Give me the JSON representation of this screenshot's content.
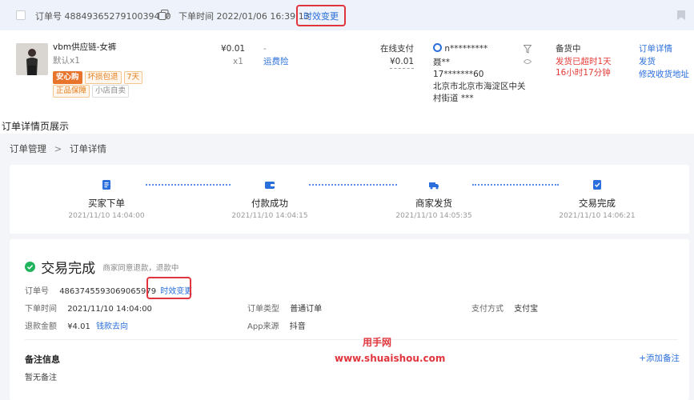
{
  "order_card": {
    "order_no_label": "订单号",
    "order_no": "4884936527910039440",
    "order_time_label": "下单时间",
    "order_time": "2022/01/06 16:39:13",
    "time_change_link": "时效变更",
    "product_name": "vbm供应链-女裤",
    "product_sku": "默认x1",
    "tags_row1": [
      "安心购",
      "坏损包退",
      "7天"
    ],
    "tags_row2": [
      "正品保障",
      "小店自卖"
    ],
    "price": "¥0.01",
    "qty": "x1",
    "dash": "-",
    "freight_link": "运费险",
    "pay_method": "在线支付",
    "pay_amount": "¥0.01",
    "buyer_nick": "n*********",
    "receiver_name": "聂**",
    "receiver_phone": "17*******60",
    "receiver_address": "北京市北京市海淀区中关村街道 ***",
    "status": "备货中",
    "overdue": "发货已超时1天",
    "overdue_time": "16小时17分钟",
    "actions": [
      "订单详情",
      "发货",
      "修改收货地址"
    ]
  },
  "caption": "订单详情页展示",
  "breadcrumb": {
    "parent": "订单管理",
    "separator": ">",
    "current": "订单详情"
  },
  "steps": [
    {
      "title": "买家下单",
      "time": "2021/11/10 14:04:00"
    },
    {
      "title": "付款成功",
      "time": "2021/11/10 14:04:15"
    },
    {
      "title": "商家发货",
      "time": "2021/11/10 14:05:35"
    },
    {
      "title": "交易完成",
      "time": "2021/11/10 14:06:21"
    }
  ],
  "detail": {
    "status_title": "交易完成",
    "status_sub": "商家同意退款，退款中",
    "order_no_label": "订单号",
    "order_no": "4863745593069065979",
    "time_change_link": "时效变更",
    "order_time_label": "下单时间",
    "order_time": "2021/11/10 14:04:00",
    "order_type_label": "订单类型",
    "order_type": "普通订单",
    "pay_method_label": "支付方式",
    "pay_method": "支付宝",
    "refund_label": "退款金额",
    "refund_amount": "¥4.01",
    "refund_link": "钱款去向",
    "app_source_label": "App来源",
    "app_source": "抖音",
    "remark_title": "备注信息",
    "add_remark": "+添加备注",
    "no_remark": "暂无备注"
  },
  "watermark": {
    "line1": "用手网",
    "line2": "www.shuaishou.com"
  },
  "colors": {
    "accent_blue": "#2a6fdb",
    "highlight_red": "#e0353d",
    "success_green": "#1fb45c",
    "header_bg": "#eef2fa"
  }
}
